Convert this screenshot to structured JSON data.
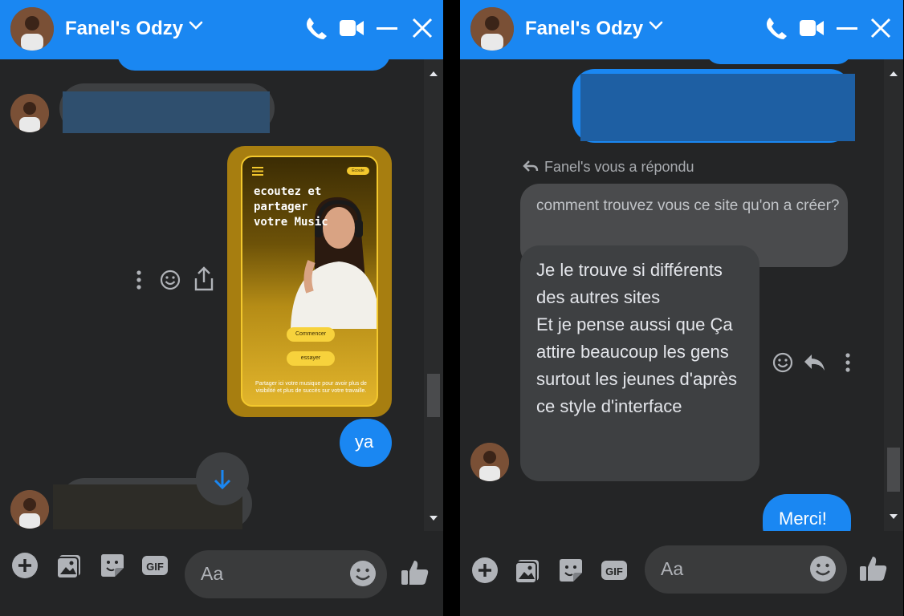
{
  "left": {
    "header": {
      "title": "Fanel's Odzy"
    },
    "poster": {
      "headline": "ecoutez et\npartager\nvotre Music",
      "pill": "Ecoute",
      "btn1": "Commencer",
      "btn2": "essayer",
      "caption": "Partager ici votre musique pour avoir plus de visibilité et plus de succès sur votre travaille."
    },
    "reply_yes": "ya",
    "composer": {
      "placeholder": "Aa"
    }
  },
  "right": {
    "header": {
      "title": "Fanel's Odzy"
    },
    "reply_indicator": "Fanel's vous a répondu",
    "quoted_message": "comment trouvez vous ce site qu'on a créer?",
    "incoming_message": "Je le trouve si différents des autres sites\nEt je pense aussi que Ça attire beaucoup les gens surtout les jeunes d'après ce style d'interface",
    "outgoing_thanks": "Merci!",
    "composer": {
      "placeholder": "Aa"
    }
  },
  "colors": {
    "header_blue": "#1a87f2",
    "background": "#242526",
    "incoming_bubble": "#3e4042",
    "outgoing_bubble": "#1a87f2"
  },
  "icons": [
    "phone-icon",
    "video-icon",
    "minimize-icon",
    "close-icon",
    "chevron-down-icon",
    "plus-icon",
    "image-icon",
    "sticker-icon",
    "gif-icon",
    "emoji-icon",
    "like-icon",
    "more-icon",
    "react-icon",
    "share-icon",
    "reply-icon",
    "scroll-down-icon"
  ]
}
